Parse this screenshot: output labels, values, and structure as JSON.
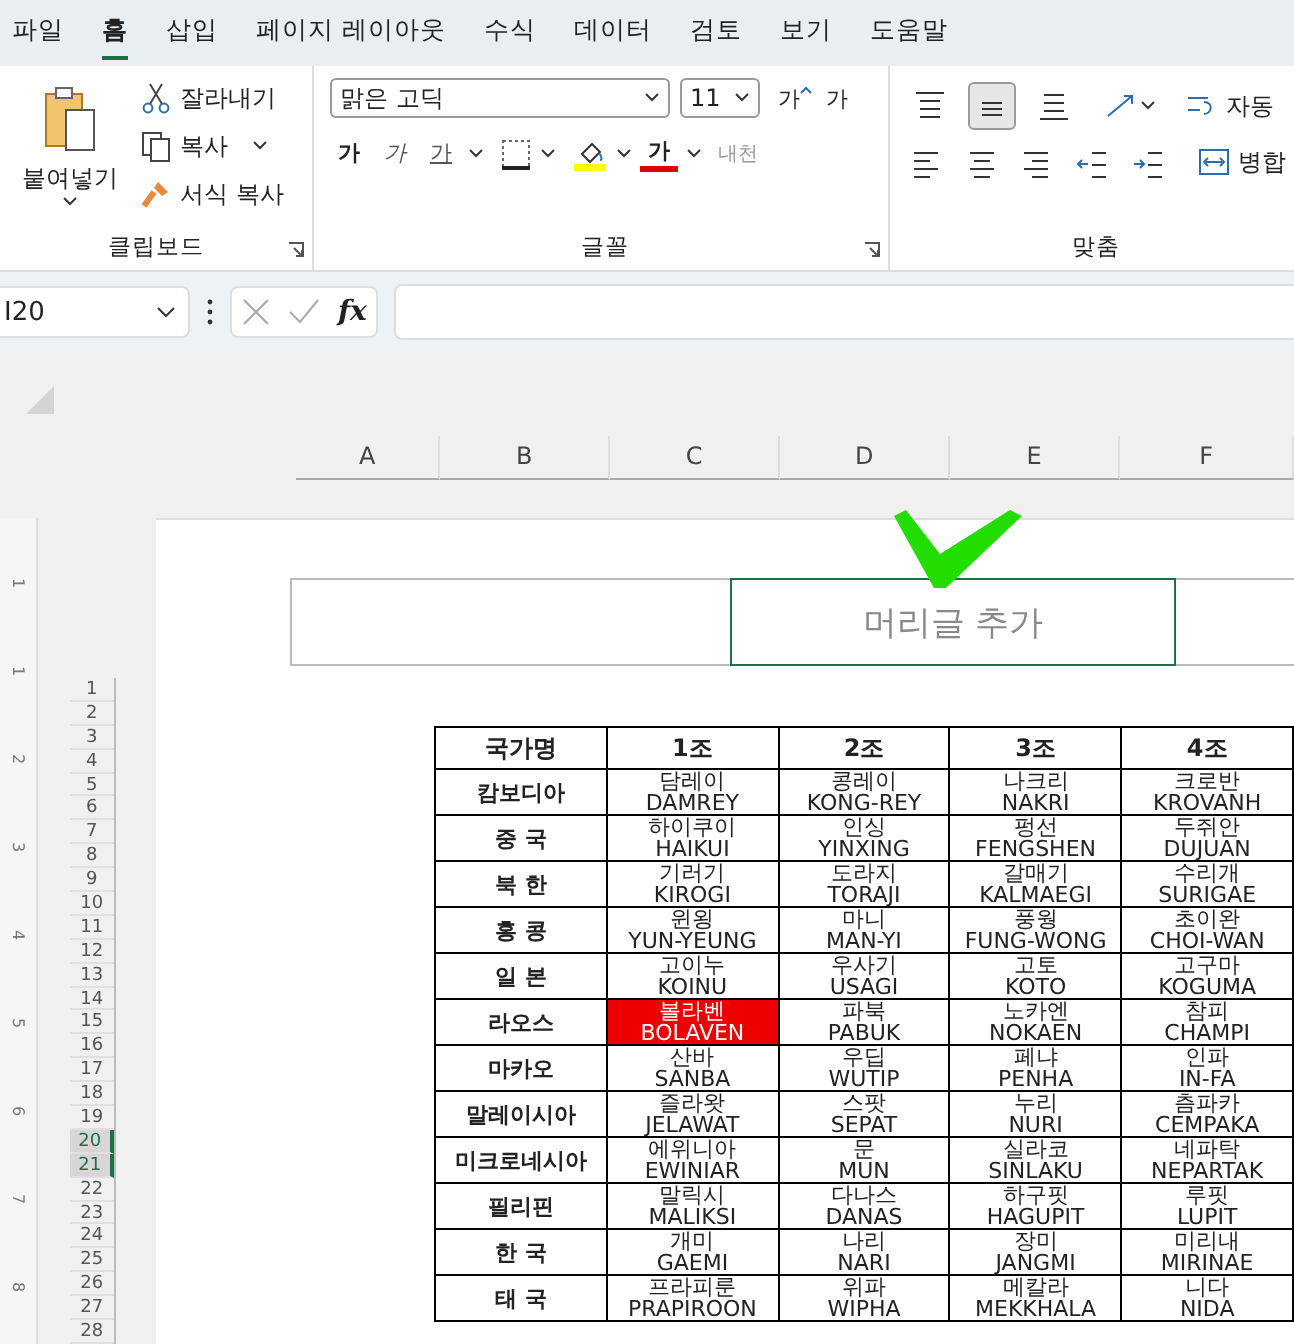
{
  "menu_tabs": [
    {
      "label": "파일",
      "selected": false
    },
    {
      "label": "홈",
      "selected": true
    },
    {
      "label": "삽입",
      "selected": false
    },
    {
      "label": "페이지 레이아웃",
      "selected": false
    },
    {
      "label": "수식",
      "selected": false
    },
    {
      "label": "데이터",
      "selected": false
    },
    {
      "label": "검토",
      "selected": false
    },
    {
      "label": "보기",
      "selected": false
    },
    {
      "label": "도움말",
      "selected": false
    }
  ],
  "ribbon": {
    "clipboard": {
      "paste": "붙여넣기",
      "cut": "잘라내기",
      "copy": "복사",
      "format_painter": "서식 복사",
      "group_label": "클립보드"
    },
    "font": {
      "font_name": "맑은 고딕",
      "font_size": "11",
      "grow": "가",
      "shrink": "가",
      "bold": "가",
      "italic": "가",
      "underline": "가",
      "font_color_label": "가",
      "phonetic": "내천",
      "group_label": "글꼴"
    },
    "alignment": {
      "vertical_buttons": [
        {
          "kind": "top",
          "selected": false
        },
        {
          "kind": "middle",
          "selected": true
        },
        {
          "kind": "bottom",
          "selected": false
        }
      ],
      "horizontal_buttons": [
        {
          "kind": "left",
          "selected": false
        },
        {
          "kind": "center",
          "selected": false
        },
        {
          "kind": "right",
          "selected": false
        },
        {
          "kind": "outdent",
          "selected": false
        },
        {
          "kind": "indent",
          "selected": false
        }
      ],
      "wrap_text": "자동",
      "merge": "병합",
      "group_label": "맞춤"
    }
  },
  "formula_bar": {
    "name_box": "I20",
    "fx": "fx"
  },
  "column_headers": [
    "A",
    "B",
    "C",
    "D",
    "E",
    "F"
  ],
  "row_numbers": [
    {
      "label": "1",
      "selected": false
    },
    {
      "label": "2",
      "selected": false
    },
    {
      "label": "3",
      "selected": false
    },
    {
      "label": "4",
      "selected": false
    },
    {
      "label": "5",
      "selected": false
    },
    {
      "label": "6",
      "selected": false
    },
    {
      "label": "7",
      "selected": false
    },
    {
      "label": "8",
      "selected": false
    },
    {
      "label": "9",
      "selected": false
    },
    {
      "label": "10",
      "selected": false
    },
    {
      "label": "11",
      "selected": false
    },
    {
      "label": "12",
      "selected": false
    },
    {
      "label": "13",
      "selected": false
    },
    {
      "label": "14",
      "selected": false
    },
    {
      "label": "15",
      "selected": false
    },
    {
      "label": "16",
      "selected": false
    },
    {
      "label": "17",
      "selected": false
    },
    {
      "label": "18",
      "selected": false
    },
    {
      "label": "19",
      "selected": false
    },
    {
      "label": "20",
      "selected": true
    },
    {
      "label": "21",
      "selected": true
    },
    {
      "label": "22",
      "selected": false
    },
    {
      "label": "23",
      "selected": false
    },
    {
      "label": "24",
      "selected": false
    },
    {
      "label": "25",
      "selected": false
    },
    {
      "label": "26",
      "selected": false
    },
    {
      "label": "27",
      "selected": false
    },
    {
      "label": "28",
      "selected": false
    }
  ],
  "ruler_marks": [
    "1",
    "1",
    "2",
    "3",
    "4",
    "5",
    "6",
    "7",
    "8"
  ],
  "page_header": {
    "placeholder": "머리글 추가"
  },
  "table": {
    "corner_heading": "국가명",
    "columns": [
      "1조",
      "2조",
      "3조",
      "4조"
    ],
    "rows": [
      {
        "country": "캄보디아",
        "cells": [
          {
            "ko": "담레이",
            "en": "DAMREY",
            "highlighted": false
          },
          {
            "ko": "콩레이",
            "en": "KONG-REY",
            "highlighted": false
          },
          {
            "ko": "나크리",
            "en": "NAKRI",
            "highlighted": false
          },
          {
            "ko": "크로반",
            "en": "KROVANH",
            "highlighted": false
          }
        ]
      },
      {
        "country": "중 국",
        "cells": [
          {
            "ko": "하이쿠이",
            "en": "HAIKUI",
            "highlighted": false
          },
          {
            "ko": "인싱",
            "en": "YINXING",
            "highlighted": false
          },
          {
            "ko": "펑선",
            "en": "FENGSHEN",
            "highlighted": false
          },
          {
            "ko": "두쥐안",
            "en": "DUJUAN",
            "highlighted": false
          }
        ]
      },
      {
        "country": "북 한",
        "cells": [
          {
            "ko": "기러기",
            "en": "KIROGI",
            "highlighted": false
          },
          {
            "ko": "도라지",
            "en": "TORAJI",
            "highlighted": false
          },
          {
            "ko": "갈매기",
            "en": "KALMAEGI",
            "highlighted": false
          },
          {
            "ko": "수리개",
            "en": "SURIGAE",
            "highlighted": false
          }
        ]
      },
      {
        "country": "홍 콩",
        "cells": [
          {
            "ko": "윈욍",
            "en": "YUN-YEUNG",
            "highlighted": false
          },
          {
            "ko": "마니",
            "en": "MAN-YI",
            "highlighted": false
          },
          {
            "ko": "풍웡",
            "en": "FUNG-WONG",
            "highlighted": false
          },
          {
            "ko": "초이완",
            "en": "CHOI-WAN",
            "highlighted": false
          }
        ]
      },
      {
        "country": "일 본",
        "cells": [
          {
            "ko": "고이누",
            "en": "KOINU",
            "highlighted": false
          },
          {
            "ko": "우사기",
            "en": "USAGI",
            "highlighted": false
          },
          {
            "ko": "고토",
            "en": "KOTO",
            "highlighted": false
          },
          {
            "ko": "고구마",
            "en": "KOGUMA",
            "highlighted": false
          }
        ]
      },
      {
        "country": "라오스",
        "cells": [
          {
            "ko": "볼라벤",
            "en": "BOLAVEN",
            "highlighted": true
          },
          {
            "ko": "파북",
            "en": "PABUK",
            "highlighted": false
          },
          {
            "ko": "노카엔",
            "en": "NOKAEN",
            "highlighted": false
          },
          {
            "ko": "참피",
            "en": "CHAMPI",
            "highlighted": false
          }
        ]
      },
      {
        "country": "마카오",
        "cells": [
          {
            "ko": "산바",
            "en": "SANBA",
            "highlighted": false
          },
          {
            "ko": "우딥",
            "en": "WUTIP",
            "highlighted": false
          },
          {
            "ko": "페냐",
            "en": "PENHA",
            "highlighted": false
          },
          {
            "ko": "인파",
            "en": "IN-FA",
            "highlighted": false
          }
        ]
      },
      {
        "country": "말레이시아",
        "cells": [
          {
            "ko": "즐라왓",
            "en": "JELAWAT",
            "highlighted": false
          },
          {
            "ko": "스팟",
            "en": "SEPAT",
            "highlighted": false
          },
          {
            "ko": "누리",
            "en": "NURI",
            "highlighted": false
          },
          {
            "ko": "츰파카",
            "en": "CEMPAKA",
            "highlighted": false
          }
        ]
      },
      {
        "country": "미크로네시아",
        "cells": [
          {
            "ko": "에위니아",
            "en": "EWINIAR",
            "highlighted": false
          },
          {
            "ko": "문",
            "en": "MUN",
            "highlighted": false
          },
          {
            "ko": "실라코",
            "en": "SINLAKU",
            "highlighted": false
          },
          {
            "ko": "네파탁",
            "en": "NEPARTAK",
            "highlighted": false
          }
        ]
      },
      {
        "country": "필리핀",
        "cells": [
          {
            "ko": "말릭시",
            "en": "MALIKSI",
            "highlighted": false
          },
          {
            "ko": "다나스",
            "en": "DANAS",
            "highlighted": false
          },
          {
            "ko": "하구핏",
            "en": "HAGUPIT",
            "highlighted": false
          },
          {
            "ko": "루핏",
            "en": "LUPIT",
            "highlighted": false
          }
        ]
      },
      {
        "country": "한 국",
        "cells": [
          {
            "ko": "개미",
            "en": "GAEMI",
            "highlighted": false
          },
          {
            "ko": "나리",
            "en": "NARI",
            "highlighted": false
          },
          {
            "ko": "장미",
            "en": "JANGMI",
            "highlighted": false
          },
          {
            "ko": "미리내",
            "en": "MIRINAE",
            "highlighted": false
          }
        ]
      },
      {
        "country": "태 국",
        "cells": [
          {
            "ko": "프라피룬",
            "en": "PRAPIROON",
            "highlighted": false
          },
          {
            "ko": "위파",
            "en": "WIPHA",
            "highlighted": false
          },
          {
            "ko": "메칼라",
            "en": "MEKKHALA",
            "highlighted": false
          },
          {
            "ko": "니다",
            "en": "NIDA",
            "highlighted": false
          }
        ]
      }
    ]
  }
}
